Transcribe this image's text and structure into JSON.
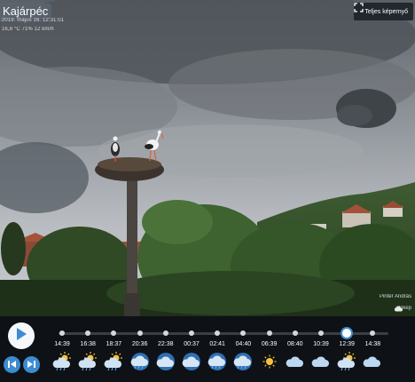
{
  "camera": {
    "title": "Kajárpéc",
    "date_line": "2019. május 16. 12:31:01",
    "weather_line": "16,8 °C 71% 12 km/h",
    "credit_author": "Pintér András",
    "credit_brand": "idokep"
  },
  "toolbar": {
    "fullscreen_label": "Teljes képernyő"
  },
  "timeline": {
    "labels": [
      "14:39",
      "16:38",
      "18:37",
      "20:36",
      "22:38",
      "00:37",
      "02:41",
      "04:40",
      "06:39",
      "08:40",
      "10:39",
      "12:39",
      "14:38"
    ],
    "icons": [
      "sun-cloud-rain-icon",
      "sun-cloud-rain-icon",
      "sun-cloud-rain-icon",
      "night-cloud-rain-icon",
      "night-cloud-icon",
      "night-cloud-icon",
      "night-cloud-rain-icon",
      "night-cloud-rain-icon",
      "sun-icon",
      "cloud-icon",
      "cloud-icon",
      "sun-cloud-rain-icon",
      "cloud-icon"
    ],
    "current_index": 11,
    "accent": "#3d8bd1"
  },
  "icons": {
    "play": "play-icon",
    "prev": "skip-back-icon",
    "next": "skip-forward-icon",
    "fullscreen": "expand-icon"
  }
}
